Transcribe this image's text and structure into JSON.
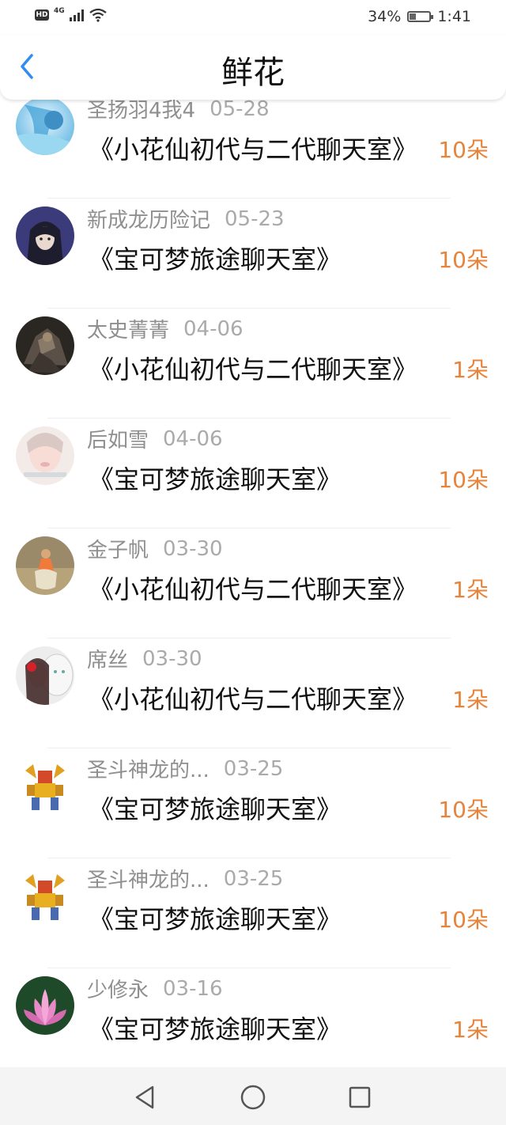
{
  "status_bar": {
    "hd_label": "HD",
    "network_label": "4G",
    "battery_percent": "34%",
    "battery_level": 0.34,
    "time": "1:41"
  },
  "header": {
    "title": "鲜花",
    "back_icon": "chevron-left-icon",
    "accent_color": "#2f8ef0"
  },
  "colors": {
    "count": "#e8833a",
    "name": "#8f8f8f",
    "room": "#111111"
  },
  "items": [
    {
      "name": "圣扬羽4我4",
      "date": "05-28",
      "room": "《小花仙初代与二代聊天室》",
      "count": "10朵",
      "avatar": "avatar-anime-blue"
    },
    {
      "name": "新成龙历险记",
      "date": "05-23",
      "room": "《宝可梦旅途聊天室》",
      "count": "10朵",
      "avatar": "avatar-anime-dark"
    },
    {
      "name": "太史菁菁",
      "date": "04-06",
      "room": "《小花仙初代与二代聊天室》",
      "count": "1朵",
      "avatar": "avatar-armor"
    },
    {
      "name": "后如雪",
      "date": "04-06",
      "room": "《宝可梦旅途聊天室》",
      "count": "10朵",
      "avatar": "avatar-face-pale"
    },
    {
      "name": "金子帆",
      "date": "03-30",
      "room": "《小花仙初代与二代聊天室》",
      "count": "1朵",
      "avatar": "avatar-photo-field"
    },
    {
      "name": "席丝",
      "date": "03-30",
      "room": "《小花仙初代与二代聊天室》",
      "count": "1朵",
      "avatar": "avatar-girl-lion"
    },
    {
      "name": "圣斗神龙的...",
      "date": "03-25",
      "room": "《宝可梦旅途聊天室》",
      "count": "10朵",
      "avatar": "avatar-robot"
    },
    {
      "name": "圣斗神龙的...",
      "date": "03-25",
      "room": "《宝可梦旅途聊天室》",
      "count": "10朵",
      "avatar": "avatar-robot"
    },
    {
      "name": "少修永",
      "date": "03-16",
      "room": "《宝可梦旅途聊天室》",
      "count": "1朵",
      "avatar": "avatar-lotus"
    }
  ],
  "nav": {
    "back": "triangle-back-icon",
    "home": "circle-home-icon",
    "recent": "square-recents-icon"
  }
}
